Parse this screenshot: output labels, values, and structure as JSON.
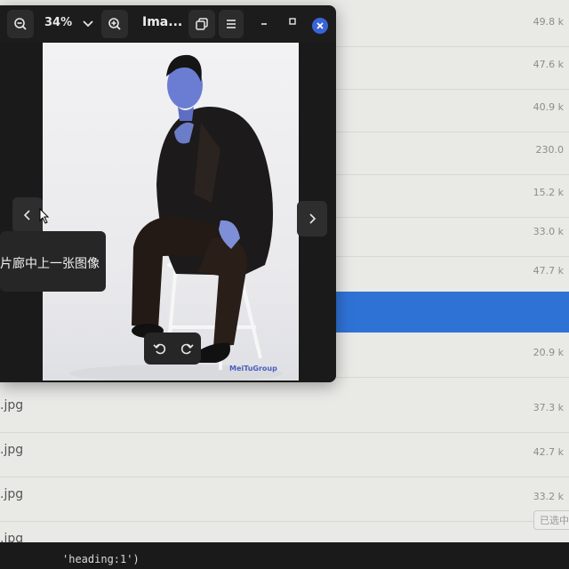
{
  "viewer": {
    "zoom": "34%",
    "title": "Ima...",
    "tooltip": "片廊中上一张图像",
    "watermark": "MeiTuGroup"
  },
  "file_list": {
    "rows": [
      {
        "name": "",
        "size": "49.8 k"
      },
      {
        "name": "",
        "size": "47.6 k"
      },
      {
        "name": "",
        "size": "40.9 k"
      },
      {
        "name": "",
        "size": "230.0"
      },
      {
        "name": "",
        "size": "15.2 k"
      },
      {
        "name": "",
        "size": "33.0 k"
      },
      {
        "name": "",
        "size": "47.7 k"
      },
      {
        "name": "",
        "size": "",
        "selected": true
      },
      {
        "name": "",
        "size": "20.9 k"
      },
      {
        "name": ".jpg",
        "size": "37.3 k"
      },
      {
        "name": ".jpg",
        "size": "42.7 k"
      },
      {
        "name": ".jpg",
        "size": "33.2 k"
      },
      {
        "name": ".jpg",
        "size": ""
      }
    ],
    "status_pill": "已选中",
    "accent": "#2f72d6"
  },
  "terminal": {
    "text": "'heading:1')"
  }
}
